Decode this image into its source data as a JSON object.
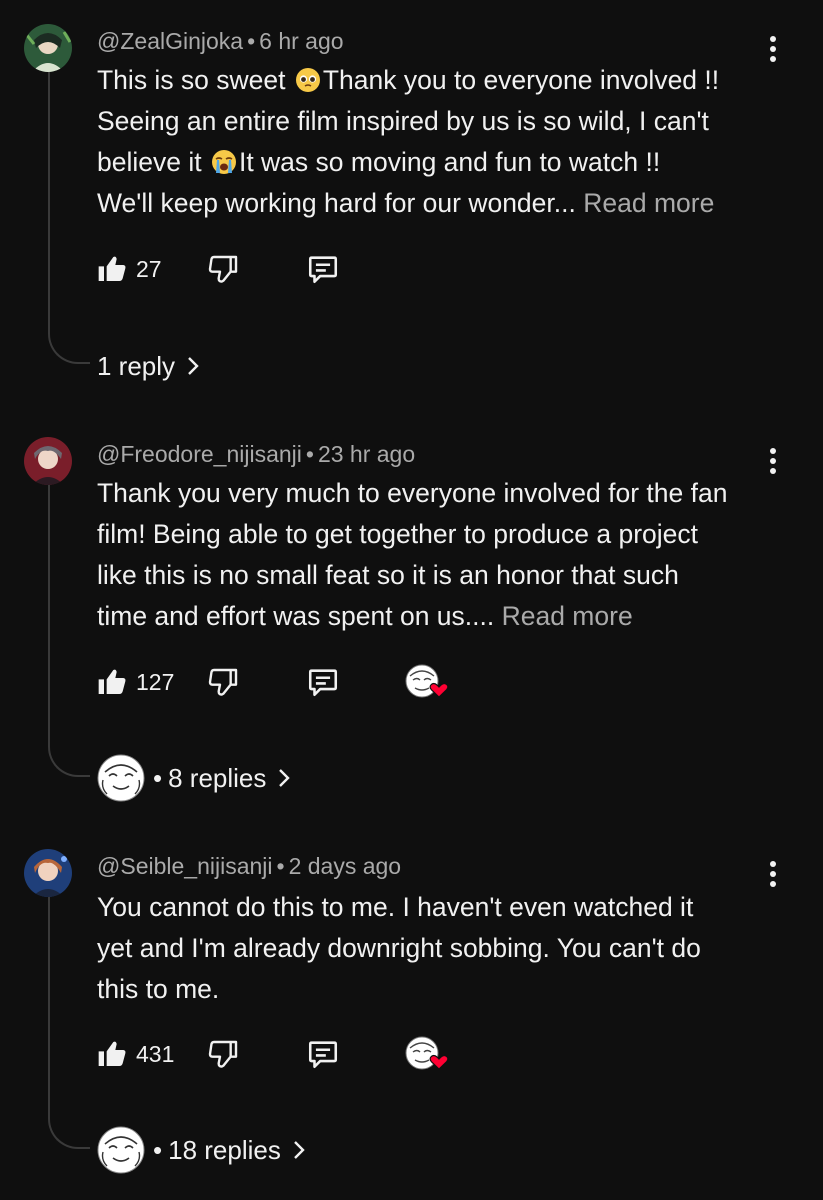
{
  "comments": [
    {
      "author": "@ZealGinjoka",
      "time": "6 hr ago",
      "lines": [
        [
          "This is so sweet ",
          "Thank you to everyone involved !!"
        ],
        [
          "Seeing an entire film inspired by us is so wild, I can't"
        ],
        [
          "believe it ",
          "It was so moving and fun to watch !!"
        ],
        [
          "We'll keep working hard for our wonder... "
        ]
      ],
      "emoji_1": "pleading-face-emoji",
      "emoji_2": "loudly-crying-face-emoji",
      "read_more": "Read more",
      "likes": "27",
      "replies": "1 reply",
      "avatar_color": "#2d5a3a"
    },
    {
      "author": "@Freodore_nijisanji",
      "time": "23 hr ago",
      "lines": [
        "Thank you very much to everyone involved for the fan",
        "film! Being able to get together to produce a  project",
        "like this is no small feat so it is an honor that such",
        "time and effort was spent on us.... "
      ],
      "read_more": "Read more",
      "likes": "127",
      "replies": "8 replies",
      "avatar_color": "#7a1e2a",
      "creator_hearted": true
    },
    {
      "author": "@Seible_nijisanji",
      "time": "2 days ago",
      "lines": [
        "You cannot do this to me. I haven't even watched it",
        "yet and I'm already downright sobbing. You can't do",
        "this to me."
      ],
      "likes": "431",
      "replies": "18 replies",
      "avatar_color": "#1f3f7a",
      "creator_hearted": true
    }
  ],
  "separator": "•",
  "icons": {
    "like": "thumbs-up-icon",
    "dislike": "thumbs-down-icon",
    "reply": "reply-comment-icon",
    "more": "more-vert-icon",
    "chevron": "chevron-right-icon",
    "heart": "creator-heart-icon"
  },
  "colors": {
    "background": "#0f0f0f",
    "text": "#f1f1f1",
    "secondary": "#aaaaaa",
    "heart": "#ff0033"
  }
}
